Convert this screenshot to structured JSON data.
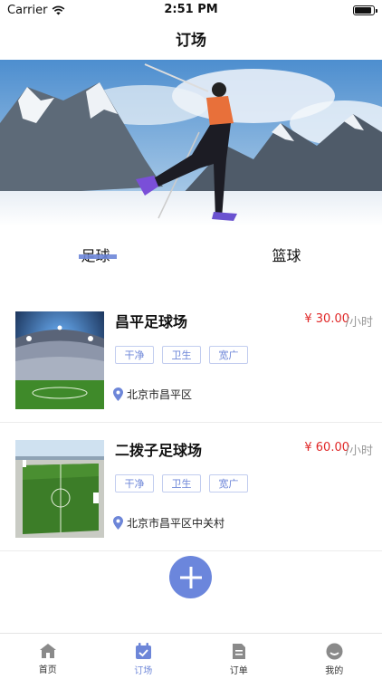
{
  "status": {
    "carrier": "Carrier",
    "time": "2:51 PM",
    "battery_level": 0.9
  },
  "nav": {
    "title": "订场"
  },
  "tabs": [
    {
      "label": "足球",
      "active": true
    },
    {
      "label": "篮球",
      "active": false
    }
  ],
  "venues": [
    {
      "name": "昌平足球场",
      "price": "¥ 30.00",
      "unit": "/小时",
      "tags": [
        "干净",
        "卫生",
        "宽广"
      ],
      "address": "北京市昌平区"
    },
    {
      "name": "二拨子足球场",
      "price": "¥ 60.00",
      "unit": "/小时",
      "tags": [
        "干净",
        "卫生",
        "宽广"
      ],
      "address": "北京市昌平区中关村"
    }
  ],
  "tabbar": [
    {
      "label": "首页",
      "icon": "home-icon",
      "active": false
    },
    {
      "label": "订场",
      "icon": "calendar-check-icon",
      "active": true
    },
    {
      "label": "订单",
      "icon": "document-icon",
      "active": false
    },
    {
      "label": "我的",
      "icon": "profile-icon",
      "active": false
    }
  ],
  "colors": {
    "accent": "#6d86d8",
    "price": "#e02626",
    "fab": "#6b86dc"
  }
}
